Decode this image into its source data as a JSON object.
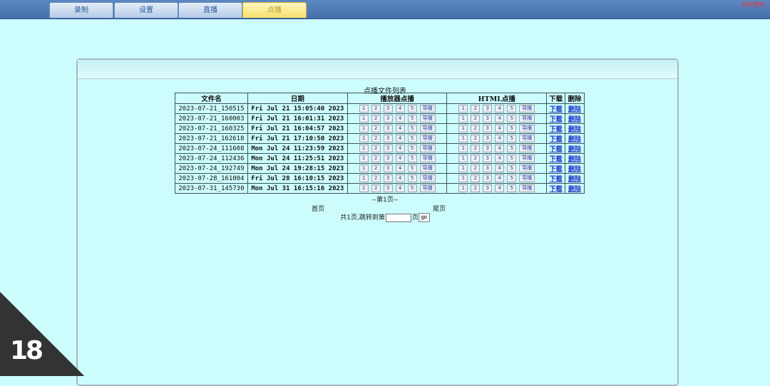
{
  "tabs": [
    {
      "label": "录制",
      "active": false
    },
    {
      "label": "设置",
      "active": false
    },
    {
      "label": "直播",
      "active": false
    },
    {
      "label": "点播",
      "active": true
    }
  ],
  "top_link": "系统管理",
  "list": {
    "title": "点播文件列表",
    "headers": {
      "filename": "文件名",
      "date": "日期",
      "player": "播放器点播",
      "html": "HTML点播",
      "download": "下载",
      "delete": "删除"
    },
    "play_buttons": [
      "1",
      "2",
      "3",
      "4",
      "5",
      "导播"
    ],
    "download_label": "下载",
    "delete_label": "删除",
    "rows": [
      {
        "name": "2023-07-21_150515",
        "date": "Fri Jul 21 15:05:40 2023"
      },
      {
        "name": "2023-07-21_160003",
        "date": "Fri Jul 21 16:01:31 2023"
      },
      {
        "name": "2023-07-21_160325",
        "date": "Fri Jul 21 16:04:57 2023"
      },
      {
        "name": "2023-07-21_162618",
        "date": "Fri Jul 21 17:10:50 2023"
      },
      {
        "name": "2023-07-24_111608",
        "date": "Mon Jul 24 11:23:59 2023"
      },
      {
        "name": "2023-07-24_112436",
        "date": "Mon Jul 24 11:25:51 2023"
      },
      {
        "name": "2023-07-24_192749",
        "date": "Mon Jul 24 19:28:15 2023"
      },
      {
        "name": "2023-07-28_161004",
        "date": "Fri Jul 28 16:10:15 2023"
      },
      {
        "name": "2023-07-31_145730",
        "date": "Mon Jul 31 16:15:16 2023"
      }
    ]
  },
  "pager": {
    "current": "--第1页--",
    "first": "首页",
    "last": "尾页",
    "jump_prefix": "共1页,跳转到第",
    "jump_suffix": "页",
    "page_input": "",
    "go": "go"
  },
  "badge": "18"
}
